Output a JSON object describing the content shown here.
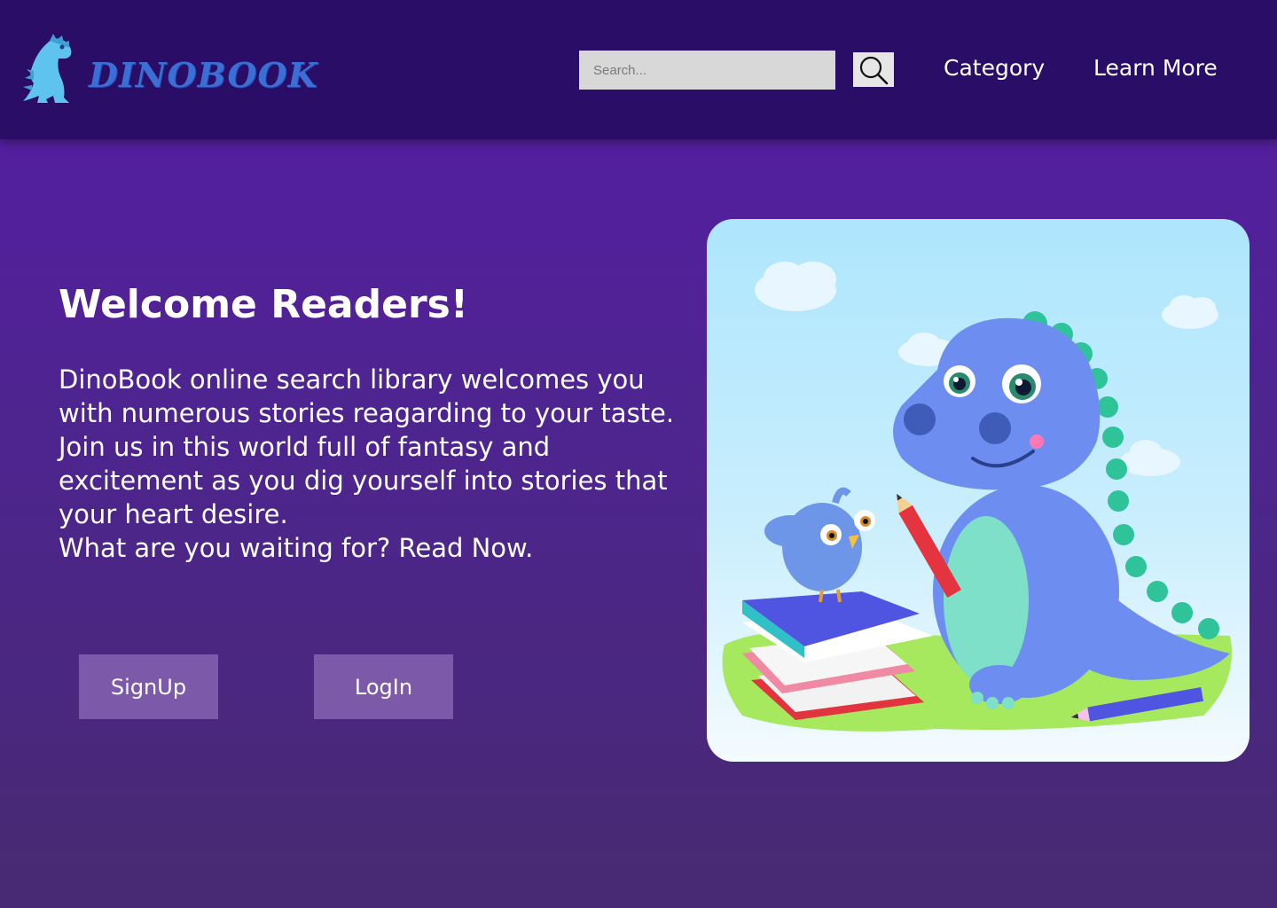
{
  "header": {
    "brand": "DINOBOOK",
    "search": {
      "placeholder": "Search...",
      "value": ""
    },
    "nav": {
      "category": "Category",
      "learn_more": "Learn More"
    }
  },
  "hero": {
    "title": "Welcome Readers!",
    "paragraphs": [
      "DinoBook online search library welcomes you with numerous stories reagarding to your taste.",
      "Join us in this world full of fantasy and excitement as you dig yourself into stories that your heart desire.",
      "What are you waiting for? Read Now."
    ],
    "buttons": {
      "signup": "SignUp",
      "login": "LogIn"
    }
  },
  "illustration": {
    "icon": "dinosaur-reading-illustration"
  },
  "colors": {
    "header_bg": "#290d66",
    "page_bg_top": "#561ca6",
    "page_bg_bottom": "#472a72",
    "button_bg": "#7d59a9",
    "search_bg": "#d8d8d8"
  }
}
